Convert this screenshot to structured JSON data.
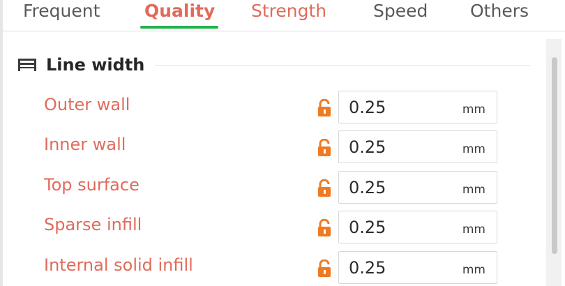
{
  "tabs": [
    {
      "label": "Frequent",
      "state": "normal"
    },
    {
      "label": "Quality",
      "state": "active"
    },
    {
      "label": "Strength",
      "state": "modified"
    },
    {
      "label": "Speed",
      "state": "normal"
    },
    {
      "label": "Others",
      "state": "normal"
    }
  ],
  "section": {
    "title": "Line width",
    "icon": "line-width-icon"
  },
  "rows": [
    {
      "label": "Outer wall",
      "value": "0.25",
      "unit": "mm",
      "icon": "unlocked-padlock-icon"
    },
    {
      "label": "Inner wall",
      "value": "0.25",
      "unit": "mm",
      "icon": "unlocked-padlock-icon"
    },
    {
      "label": "Top surface",
      "value": "0.25",
      "unit": "mm",
      "icon": "unlocked-padlock-icon"
    },
    {
      "label": "Sparse infill",
      "value": "0.25",
      "unit": "mm",
      "icon": "unlocked-padlock-icon"
    },
    {
      "label": "Internal solid infill",
      "value": "0.25",
      "unit": "mm",
      "icon": "unlocked-padlock-icon"
    }
  ],
  "colors": {
    "accent_green": "#22b24c",
    "modified_label": "#e06b5b",
    "lock_orange": "#f07a22"
  }
}
